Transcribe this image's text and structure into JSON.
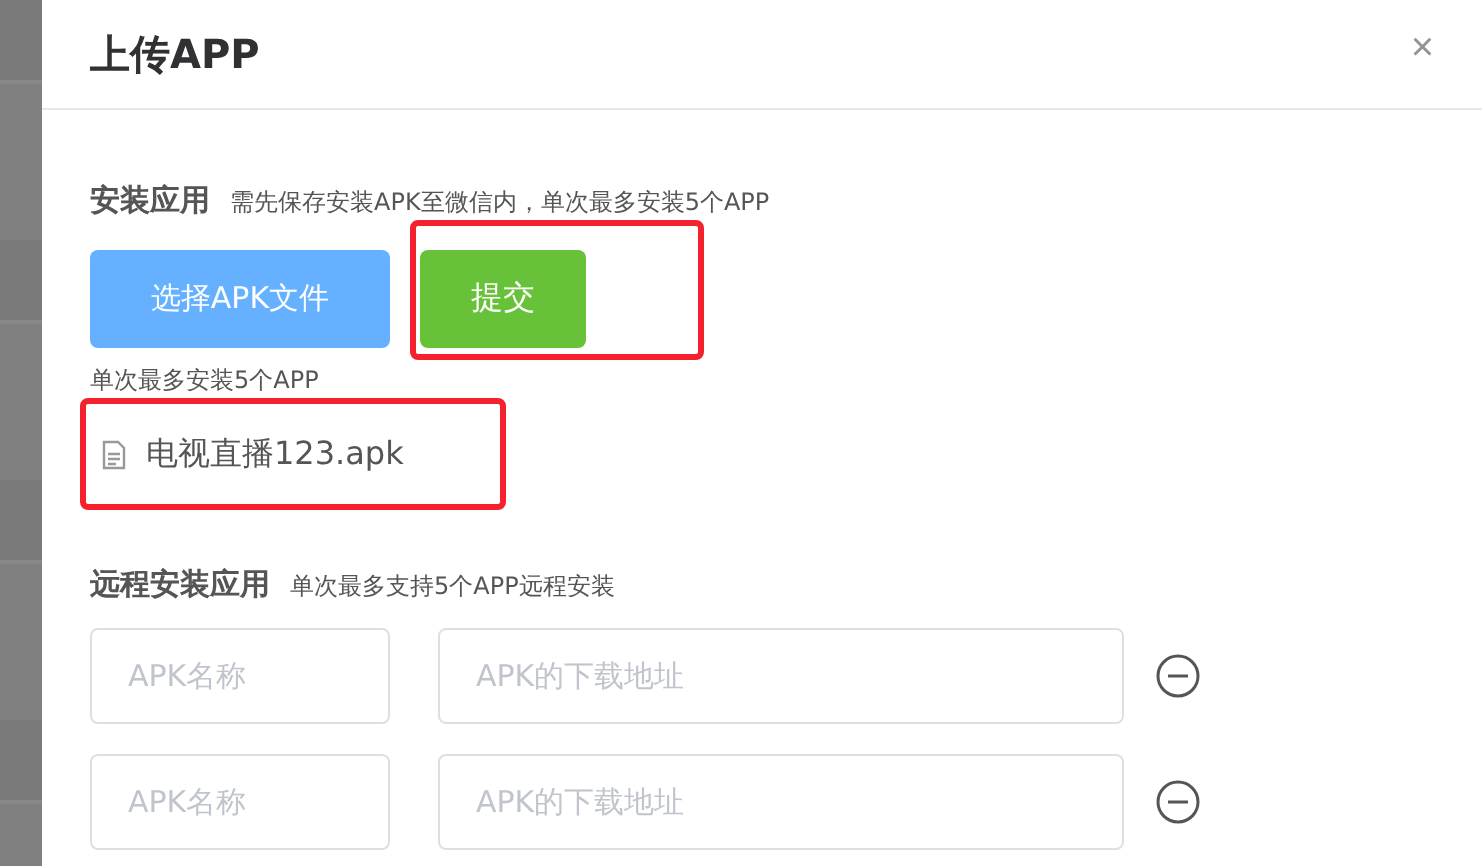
{
  "dialog": {
    "title": "上传APP",
    "close": "×"
  },
  "install": {
    "label": "安装应用",
    "hint": "需先保存安装APK至微信内，单次最多安装5个APP",
    "choose_button": {
      "label": "选择APK文件"
    },
    "submit_button": {
      "label": "提交",
      "highlighted": true
    },
    "limit_note": "单次最多安装5个APP",
    "files": [
      {
        "name": "电视直播123.apk",
        "highlighted": true
      }
    ]
  },
  "remote": {
    "label": "远程安装应用",
    "hint": "单次最多支持5个APP远程安装",
    "rows": [
      {
        "name": {
          "placeholder": "APK名称"
        },
        "url": {
          "placeholder": "APK的下载地址"
        }
      },
      {
        "name": {
          "placeholder": "APK名称"
        },
        "url": {
          "placeholder": "APK的下载地址"
        }
      }
    ]
  }
}
